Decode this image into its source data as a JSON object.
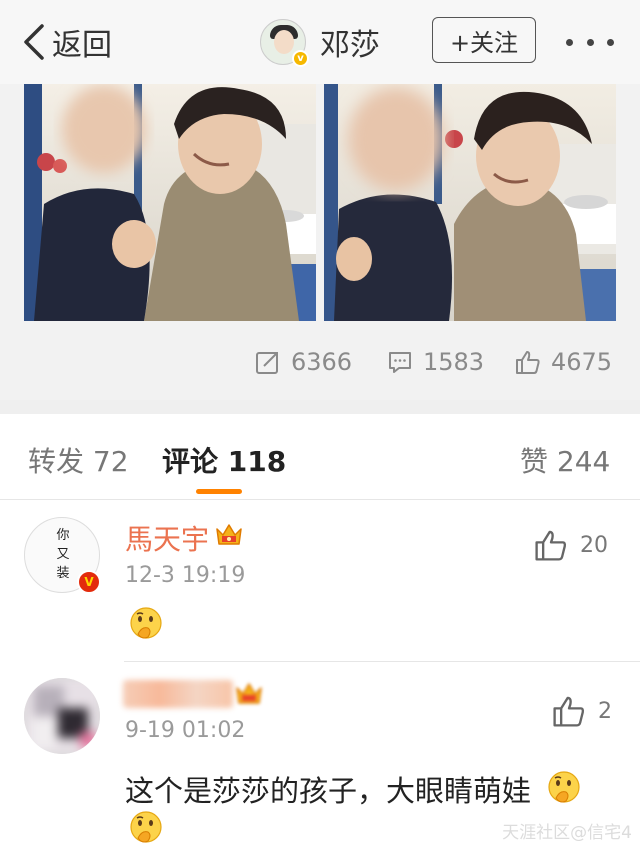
{
  "nav": {
    "back_label": "返回",
    "title": "邓莎",
    "follow_label": "+关注"
  },
  "post": {
    "stats": {
      "reposts": "6366",
      "comments": "1583",
      "likes": "4675"
    }
  },
  "tabs": {
    "repost": "转发 72",
    "comment": "评论 118",
    "like": "赞 244"
  },
  "comments": [
    {
      "name": "馬天宇",
      "time": "12-3 19:19",
      "likes": "20",
      "avatar_text": "你又装",
      "emoji": "thinking-emoji"
    },
    {
      "name": "",
      "time": "9-19 01:02",
      "likes": "2",
      "text": "这个是莎莎的孩子，大眼睛萌娃"
    }
  ],
  "watermark": "天涯社区@信宅4",
  "colors": {
    "accent": "#ff8200",
    "username": "#eb7350",
    "nav_bg": "#f7f7f7",
    "gray_text": "#9a9a9a"
  },
  "icons": [
    "chevron-left-icon",
    "repost-icon",
    "comment-icon",
    "thumbs-up-icon",
    "crown-icon",
    "more-icon",
    "verified-icon"
  ]
}
